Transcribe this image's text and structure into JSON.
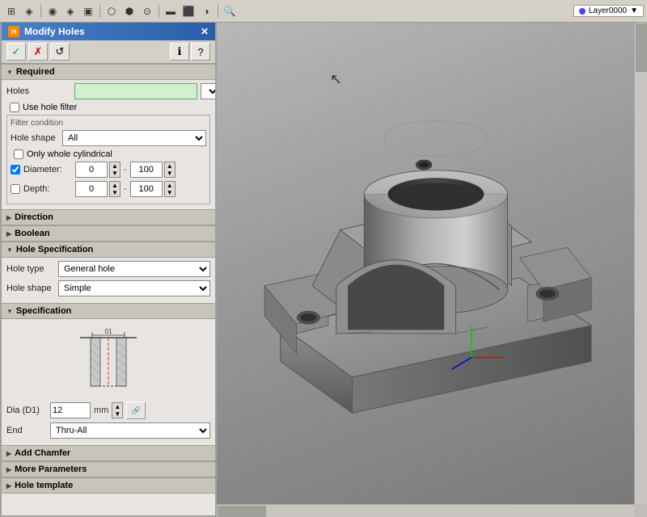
{
  "app": {
    "title": "Modify Holes",
    "layer": "Layer0000"
  },
  "toolbar": {
    "icons": [
      "⊞",
      "⊟",
      "⊕",
      "⊗",
      "◈",
      "▣",
      "◀",
      "▶",
      "◉",
      "⬡",
      "⬢",
      "⬛",
      "▬",
      "⊙",
      "◑"
    ]
  },
  "dialog": {
    "title": "Modify Holes",
    "sections": {
      "required": {
        "label": "Required",
        "expanded": true
      },
      "direction": {
        "label": "Direction",
        "expanded": false
      },
      "boolean": {
        "label": "Boolean",
        "expanded": false
      },
      "hole_specification": {
        "label": "Hole Specification",
        "expanded": true
      },
      "specification": {
        "label": "Specification",
        "expanded": true
      },
      "add_chamfer": {
        "label": "Add Chamfer",
        "expanded": false
      },
      "more_parameters": {
        "label": "More Parameters",
        "expanded": false
      },
      "hole_template": {
        "label": "Hole template",
        "expanded": false
      }
    },
    "fields": {
      "holes_label": "Holes",
      "holes_placeholder": "",
      "use_hole_filter": "Use hole filter",
      "filter_condition": "Filter condition",
      "hole_shape_label": "Hole shape",
      "hole_shape_value": "All",
      "only_whole_cylindrical": "Only whole cylindrical",
      "diameter_label": "Diameter:",
      "diameter_min": "0",
      "diameter_max": "100",
      "depth_label": "Depth:",
      "depth_min": "0",
      "depth_max": "100",
      "hole_type_label": "Hole type",
      "hole_type_value": "General hole",
      "hole_shape_label2": "Hole shape",
      "hole_shape_value2": "Simple",
      "dia_d1_label": "Dia (D1)",
      "dia_d1_value": "12",
      "dia_unit": "mm",
      "end_label": "End",
      "end_value": "Thru-All"
    },
    "buttons": {
      "ok": "✓",
      "cancel": "✗",
      "apply": "↺"
    }
  }
}
